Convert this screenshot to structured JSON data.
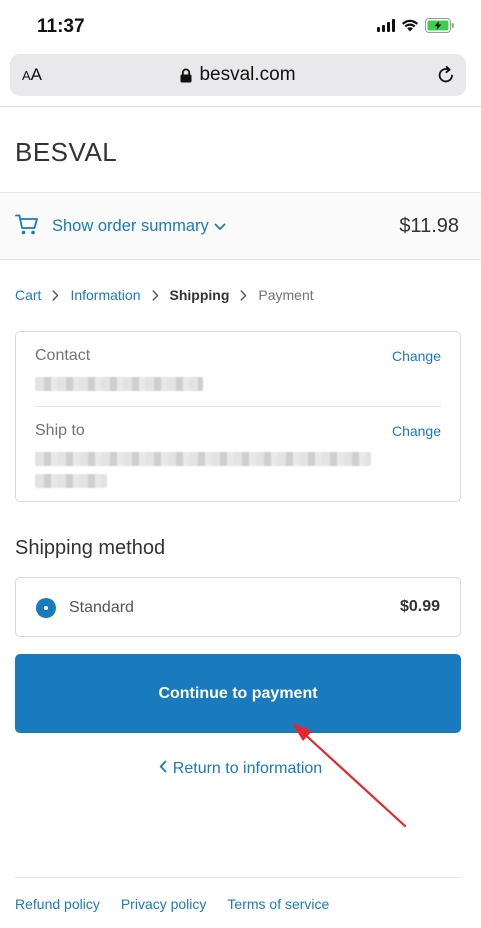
{
  "status_bar": {
    "time": "11:37"
  },
  "browser": {
    "aa_label_small": "A",
    "aa_label_large": "A",
    "url": "besval.com"
  },
  "store": {
    "name": "BESVAL"
  },
  "order_summary": {
    "toggle_label": "Show order summary",
    "total": "$11.98"
  },
  "breadcrumb": {
    "items": [
      "Cart",
      "Information",
      "Shipping",
      "Payment"
    ]
  },
  "review": {
    "contact_label": "Contact",
    "ship_to_label": "Ship to",
    "change_label": "Change"
  },
  "shipping": {
    "section_title": "Shipping method",
    "rate_name": "Standard",
    "rate_price": "$0.99"
  },
  "actions": {
    "continue_label": "Continue to payment",
    "return_label": "Return to information"
  },
  "footer": {
    "links": [
      "Refund policy",
      "Privacy policy",
      "Terms of service"
    ]
  },
  "colors": {
    "accent": "#197bbd",
    "annotation": "#e8252b"
  }
}
